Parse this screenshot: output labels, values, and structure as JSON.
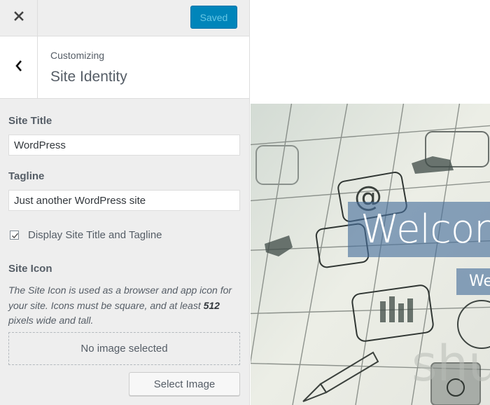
{
  "topbar": {
    "close_icon": "close-icon",
    "save_button_label": "Saved"
  },
  "section_header": {
    "back_icon": "chevron-left-icon",
    "subtitle": "Customizing",
    "title": "Site Identity"
  },
  "site_title": {
    "label": "Site Title",
    "value": "WordPress"
  },
  "tagline": {
    "label": "Tagline",
    "value": "Just another WordPress site"
  },
  "display_checkbox": {
    "label": "Display Site Title and Tagline",
    "checked": true
  },
  "site_icon": {
    "label": "Site Icon",
    "description_before": "The Site Icon is used as a browser and app icon for your site. Icons must be square, and at least ",
    "description_bold": "512",
    "description_after": " pixels wide and tall.",
    "placeholder": "No image selected",
    "select_button_label": "Select Image"
  },
  "preview": {
    "hero_title": "Welcome",
    "hero_subtitle": "Welcome",
    "watermark": "shu"
  },
  "colors": {
    "primary_button": "#0085ba",
    "sidebar_bg": "#eeeeee",
    "text": "#555d66",
    "hero_overlay": "#466e9b"
  }
}
